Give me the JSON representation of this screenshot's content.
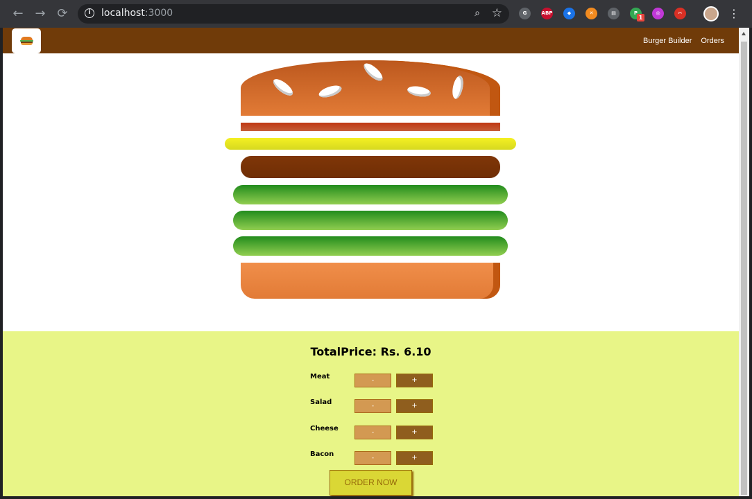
{
  "browser": {
    "url_host": "localhost",
    "url_port": ":3000",
    "extensions": [
      {
        "name": "grammarly-icon",
        "text": "G",
        "color": "#5f6368"
      },
      {
        "name": "adblock-icon",
        "text": "ABP",
        "color": "#c8102e"
      },
      {
        "name": "dev-tool-icon",
        "text": "◆",
        "color": "#1a73e8"
      },
      {
        "name": "crossover-icon",
        "text": "✕",
        "color": "#f28b20"
      },
      {
        "name": "printer-icon",
        "text": "▤",
        "color": "#5f6368"
      },
      {
        "name": "pushbullet-icon",
        "text": "P",
        "color": "#34a853"
      },
      {
        "name": "hoverzoom-icon",
        "text": "◎",
        "color": "#c038d6"
      },
      {
        "name": "screenshot-icon",
        "text": "✂",
        "color": "#d93025"
      }
    ],
    "pushbullet_badge": "1"
  },
  "toolbar": {
    "nav": [
      "Burger Builder",
      "Orders"
    ]
  },
  "build_controls": {
    "total_price": "TotalPrice: Rs. 6.10",
    "less_label": "-",
    "more_label": "+",
    "ingredients": [
      "Meat",
      "Salad",
      "Cheese",
      "Bacon"
    ],
    "order_label": "ORDER NOW"
  },
  "colors": {
    "toolbar": "#703b09",
    "controls_bg": "#e8f587",
    "order_button": "#dad735"
  }
}
